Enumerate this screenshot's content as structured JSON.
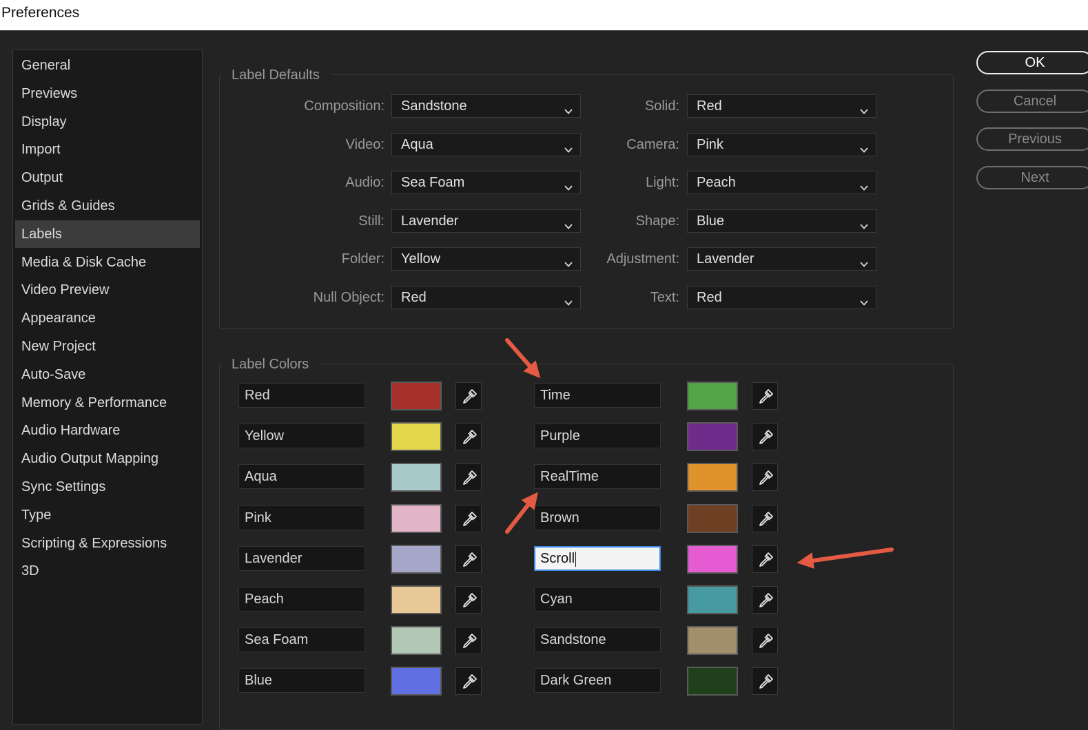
{
  "window": {
    "title": "Preferences"
  },
  "sidebar": {
    "items": [
      {
        "label": "General"
      },
      {
        "label": "Previews"
      },
      {
        "label": "Display"
      },
      {
        "label": "Import"
      },
      {
        "label": "Output"
      },
      {
        "label": "Grids & Guides"
      },
      {
        "label": "Labels",
        "selected": true
      },
      {
        "label": "Media & Disk Cache"
      },
      {
        "label": "Video Preview"
      },
      {
        "label": "Appearance"
      },
      {
        "label": "New Project"
      },
      {
        "label": "Auto-Save"
      },
      {
        "label": "Memory & Performance"
      },
      {
        "label": "Audio Hardware"
      },
      {
        "label": "Audio Output Mapping"
      },
      {
        "label": "Sync Settings"
      },
      {
        "label": "Type"
      },
      {
        "label": "Scripting & Expressions"
      },
      {
        "label": "3D"
      }
    ]
  },
  "label_defaults": {
    "title": "Label Defaults",
    "left": [
      {
        "label": "Composition:",
        "value": "Sandstone"
      },
      {
        "label": "Video:",
        "value": "Aqua"
      },
      {
        "label": "Audio:",
        "value": "Sea Foam"
      },
      {
        "label": "Still:",
        "value": "Lavender"
      },
      {
        "label": "Folder:",
        "value": "Yellow"
      },
      {
        "label": "Null Object:",
        "value": "Red"
      }
    ],
    "right": [
      {
        "label": "Solid:",
        "value": "Red"
      },
      {
        "label": "Camera:",
        "value": "Pink"
      },
      {
        "label": "Light:",
        "value": "Peach"
      },
      {
        "label": "Shape:",
        "value": "Blue"
      },
      {
        "label": "Adjustment:",
        "value": "Lavender"
      },
      {
        "label": "Text:",
        "value": "Red"
      }
    ]
  },
  "label_colors": {
    "title": "Label Colors",
    "left": [
      {
        "name": "Red",
        "color": "#a5302c"
      },
      {
        "name": "Yellow",
        "color": "#e3d64b"
      },
      {
        "name": "Aqua",
        "color": "#a8c9c9"
      },
      {
        "name": "Pink",
        "color": "#e3b5c8"
      },
      {
        "name": "Lavender",
        "color": "#a6a6c8"
      },
      {
        "name": "Peach",
        "color": "#e8c896"
      },
      {
        "name": "Sea Foam",
        "color": "#b2c7b4"
      },
      {
        "name": "Blue",
        "color": "#6070e3"
      }
    ],
    "right": [
      {
        "name": "Time",
        "color": "#52a446"
      },
      {
        "name": "Purple",
        "color": "#702b8b"
      },
      {
        "name": "RealTime",
        "color": "#e0922c"
      },
      {
        "name": "Brown",
        "color": "#6e3f22"
      },
      {
        "name": "Scroll",
        "color": "#e45bd2",
        "editing": true
      },
      {
        "name": "Cyan",
        "color": "#479a9f"
      },
      {
        "name": "Sandstone",
        "color": "#a28f6c"
      },
      {
        "name": "Dark Green",
        "color": "#20401c"
      }
    ]
  },
  "buttons": {
    "ok": "OK",
    "cancel": "Cancel",
    "previous": "Previous",
    "next": "Next"
  },
  "annotations": {
    "arrow_color": "#e45a43"
  }
}
